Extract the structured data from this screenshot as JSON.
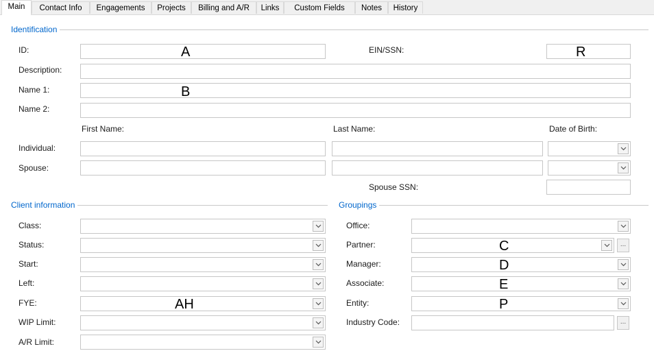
{
  "tabs": [
    "Main",
    "Contact Info",
    "Engagements",
    "Projects",
    "Billing and A/R",
    "Links",
    "Custom Fields",
    "Notes",
    "History"
  ],
  "identification": {
    "title": "Identification",
    "id_label": "ID:",
    "ein_label": "EIN/SSN:",
    "description_label": "Description:",
    "name1_label": "Name 1:",
    "name2_label": "Name 2:",
    "first_name_header": "First Name:",
    "last_name_header": "Last Name:",
    "dob_header": "Date of Birth:",
    "individual_label": "Individual:",
    "spouse_label": "Spouse:",
    "spouse_ssn_label": "Spouse SSN:"
  },
  "client_info": {
    "title": "Client information",
    "class_label": "Class:",
    "status_label": "Status:",
    "start_label": "Start:",
    "left_label": "Left:",
    "fye_label": "FYE:",
    "wip_limit_label": "WIP Limit:",
    "ar_limit_label": "A/R Limit:"
  },
  "groupings": {
    "title": "Groupings",
    "office_label": "Office:",
    "partner_label": "Partner:",
    "manager_label": "Manager:",
    "associate_label": "Associate:",
    "entity_label": "Entity:",
    "industry_code_label": "Industry Code:",
    "ellipsis": "..."
  },
  "overlays": {
    "a": "A",
    "r": "R",
    "b": "B",
    "c": "C",
    "d": "D",
    "e": "E",
    "p": "P",
    "ah": "AH"
  },
  "colors": {
    "group_title": "#0066cc",
    "border": "#c6c6c6",
    "tab_bg": "#f0f0f0"
  }
}
